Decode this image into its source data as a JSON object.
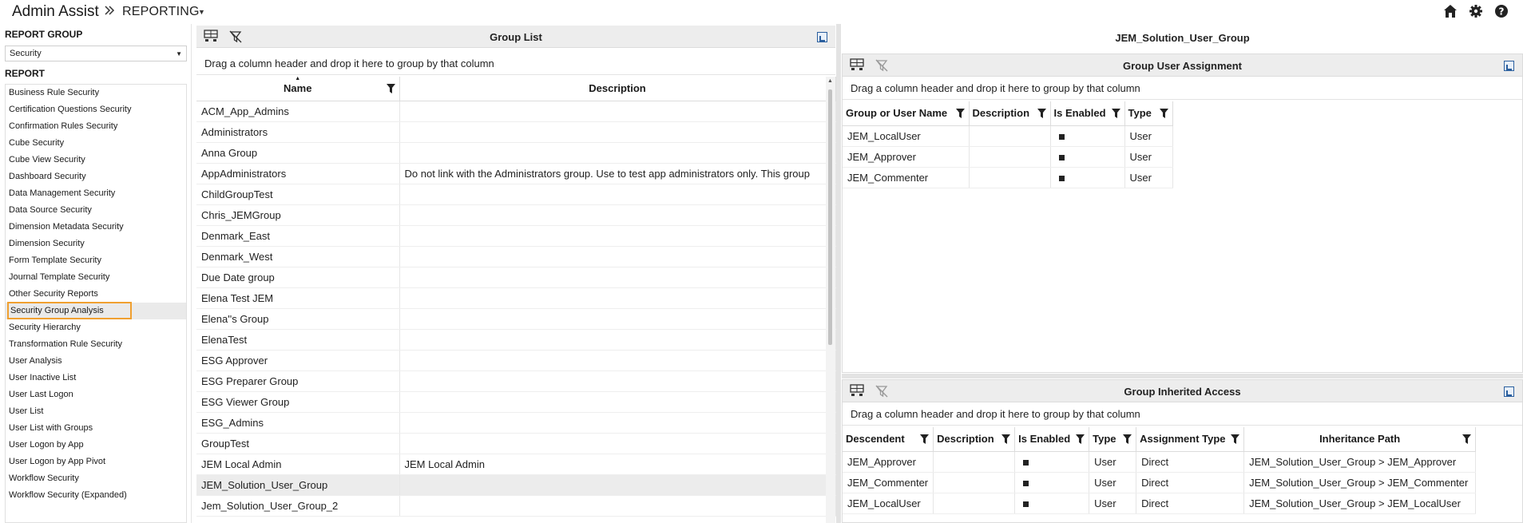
{
  "header": {
    "app_title": "Admin Assist",
    "breadcrumb": "REPORTING",
    "icons": [
      "home-icon",
      "gear-icon",
      "help-icon"
    ]
  },
  "left": {
    "report_group_title": "REPORT GROUP",
    "report_group_value": "Security",
    "report_title": "REPORT",
    "reports": [
      "Business Rule Security",
      "Certification Questions Security",
      "Confirmation Rules Security",
      "Cube Security",
      "Cube View Security",
      "Dashboard Security",
      "Data Management Security",
      "Data Source Security",
      "Dimension Metadata Security",
      "Dimension Security",
      "Form Template Security",
      "Journal Template Security",
      "Other Security Reports",
      "Security Group Analysis",
      "Security Hierarchy",
      "Transformation Rule Security",
      "User Analysis",
      "User Inactive List",
      "User Last Logon",
      "User List",
      "User List with Groups",
      "User Logon by App",
      "User Logon by App Pivot",
      "Workflow Security",
      "Workflow Security (Expanded)"
    ],
    "selected_index": 13
  },
  "group_list": {
    "title": "Group List",
    "hint": "Drag a column header and drop it here to group by that column",
    "columns": [
      "Name",
      "Description"
    ],
    "rows": [
      [
        "ACM_App_Admins",
        ""
      ],
      [
        "Administrators",
        ""
      ],
      [
        "Anna Group",
        ""
      ],
      [
        "AppAdministrators",
        "Do not link with the Administrators group. Use to test app administrators only. This group"
      ],
      [
        "ChildGroupTest",
        ""
      ],
      [
        "Chris_JEMGroup",
        ""
      ],
      [
        "Denmark_East",
        ""
      ],
      [
        "Denmark_West",
        ""
      ],
      [
        "Due Date group",
        ""
      ],
      [
        "Elena Test JEM",
        ""
      ],
      [
        "Elena''s Group",
        ""
      ],
      [
        "ElenaTest",
        ""
      ],
      [
        "ESG Approver",
        ""
      ],
      [
        "ESG Preparer Group",
        ""
      ],
      [
        "ESG Viewer Group",
        ""
      ],
      [
        "ESG_Admins",
        ""
      ],
      [
        "GroupTest",
        ""
      ],
      [
        "JEM Local Admin",
        "JEM Local Admin"
      ],
      [
        "JEM_Solution_User_Group",
        ""
      ],
      [
        "Jem_Solution_User_Group_2",
        ""
      ]
    ],
    "selected_row": 18
  },
  "right": {
    "selected_group": "JEM_Solution_User_Group",
    "assignment": {
      "title": "Group User Assignment",
      "hint": "Drag a column header and drop it here to group by that column",
      "columns": [
        "Group or User Name",
        "Description",
        "Is Enabled",
        "Type"
      ],
      "rows": [
        [
          "JEM_LocalUser",
          "",
          true,
          "User"
        ],
        [
          "JEM_Approver",
          "",
          true,
          "User"
        ],
        [
          "JEM_Commenter",
          "",
          true,
          "User"
        ]
      ]
    },
    "inherited": {
      "title": "Group Inherited Access",
      "hint": "Drag a column header and drop it here to group by that column",
      "columns": [
        "Descendent",
        "Description",
        "Is Enabled",
        "Type",
        "Assignment Type",
        "Inheritance Path"
      ],
      "rows": [
        [
          "JEM_Approver",
          "",
          true,
          "User",
          "Direct",
          "JEM_Solution_User_Group > JEM_Approver"
        ],
        [
          "JEM_Commenter",
          "",
          true,
          "User",
          "Direct",
          "JEM_Solution_User_Group > JEM_Commenter"
        ],
        [
          "JEM_LocalUser",
          "",
          true,
          "User",
          "Direct",
          "JEM_Solution_User_Group > JEM_LocalUser"
        ]
      ]
    }
  }
}
